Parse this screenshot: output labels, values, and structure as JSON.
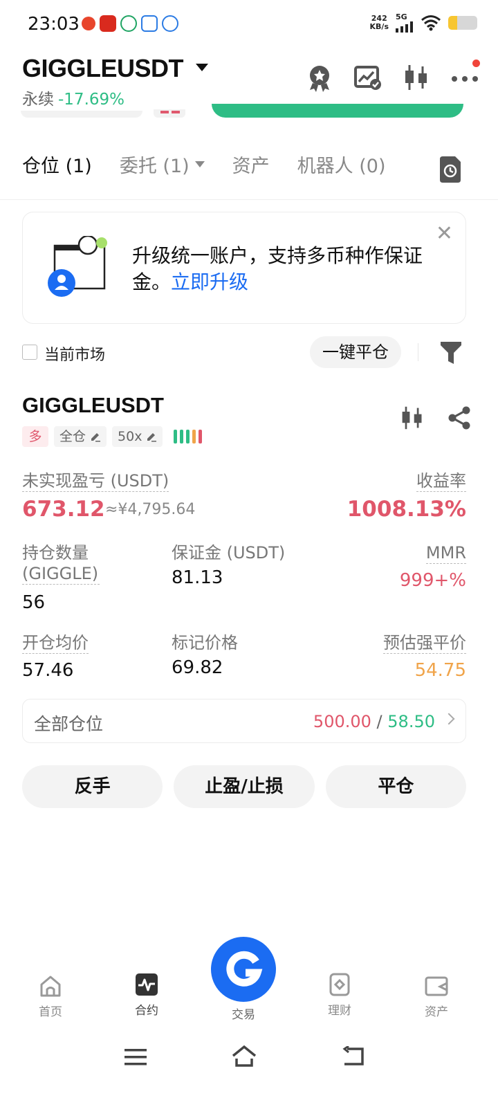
{
  "status_bar": {
    "time": "23:03",
    "net_speed_value": "242",
    "net_speed_unit": "KB/s",
    "network": "5G",
    "battery_level": 0.3,
    "battery_color": "#f7c631"
  },
  "header": {
    "symbol": "GIGGLEUSDT",
    "contract_type": "永续",
    "change_pct": "-17.69%",
    "icons": [
      "award-icon",
      "chart-settings-icon",
      "candlestick-icon",
      "more-icon"
    ]
  },
  "tabs": [
    {
      "label": "仓位 (1)",
      "active": true
    },
    {
      "label": "委托 (1)",
      "active": false,
      "has_dropdown": true
    },
    {
      "label": "资产",
      "active": false
    },
    {
      "label": "机器人 (0)",
      "active": false
    }
  ],
  "banner": {
    "text": "升级统一账户，支持多币种作保证金。",
    "link": "立即升级"
  },
  "filter": {
    "current_market_label": "当前市场",
    "current_market_checked": false,
    "close_all_label": "一键平仓"
  },
  "position": {
    "symbol": "GIGGLEUSDT",
    "side_tag": "多",
    "margin_mode_tag": "全仓",
    "leverage_tag": "50x",
    "risk_level": 5,
    "unrealized_pnl_label": "未实现盈亏 (USDT)",
    "unrealized_pnl": "673.12",
    "unrealized_pnl_cny": "≈¥4,795.64",
    "roe_label": "收益率",
    "roe": "1008.13%",
    "size_label": "持仓数量 (GIGGLE)",
    "size": "56",
    "margin_label": "保证金 (USDT)",
    "margin": "81.13",
    "mmr_label": "MMR",
    "mmr": "999+%",
    "entry_price_label": "开仓均价",
    "entry_price": "57.46",
    "mark_price_label": "标记价格",
    "mark_price": "69.82",
    "liq_price_label": "预估强平价",
    "liq_price": "54.75"
  },
  "all_positions": {
    "label": "全部仓位",
    "value_left": "500.00",
    "separator": "/",
    "value_right": "58.50"
  },
  "actions": {
    "reverse": "反手",
    "tp_sl": "止盈/止损",
    "close": "平仓"
  },
  "bottom_nav": {
    "home": "首页",
    "contract": "合约",
    "trade": "交易",
    "finance": "理财",
    "assets": "资产"
  },
  "colors": {
    "red": "#e0566a",
    "green": "#2ebd85",
    "blue": "#1b6cf2",
    "orange": "#f0a44a"
  }
}
